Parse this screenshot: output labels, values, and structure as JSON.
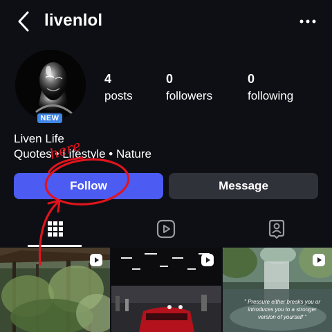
{
  "header": {
    "username": "livenlol"
  },
  "profile": {
    "badge": "NEW",
    "stats": [
      {
        "value": "4",
        "label": "posts"
      },
      {
        "value": "0",
        "label": "followers"
      },
      {
        "value": "0",
        "label": "following"
      }
    ],
    "name": "Liven Life",
    "tags": "Quotes • Lifestyle • Nature"
  },
  "actions": {
    "follow_label": "Follow",
    "message_label": "Message"
  },
  "tabs": [
    {
      "icon": "grid-icon",
      "active": true
    },
    {
      "icon": "reels-icon",
      "active": false
    },
    {
      "icon": "tagged-icon",
      "active": false
    }
  ],
  "posts": [
    {
      "type": "reel",
      "scene": "forest"
    },
    {
      "type": "reel",
      "scene": "car-show"
    },
    {
      "type": "reel",
      "scene": "waterfall",
      "caption": "\" Pressure either breaks you or introduces you to a stronger version of yourself \""
    }
  ],
  "annotation": {
    "text": "here",
    "color": "#e0141e"
  },
  "colors": {
    "background": "#0d0f14",
    "follow": "#4c5bf2",
    "message": "#30323a",
    "badge": "#3f86e6"
  }
}
